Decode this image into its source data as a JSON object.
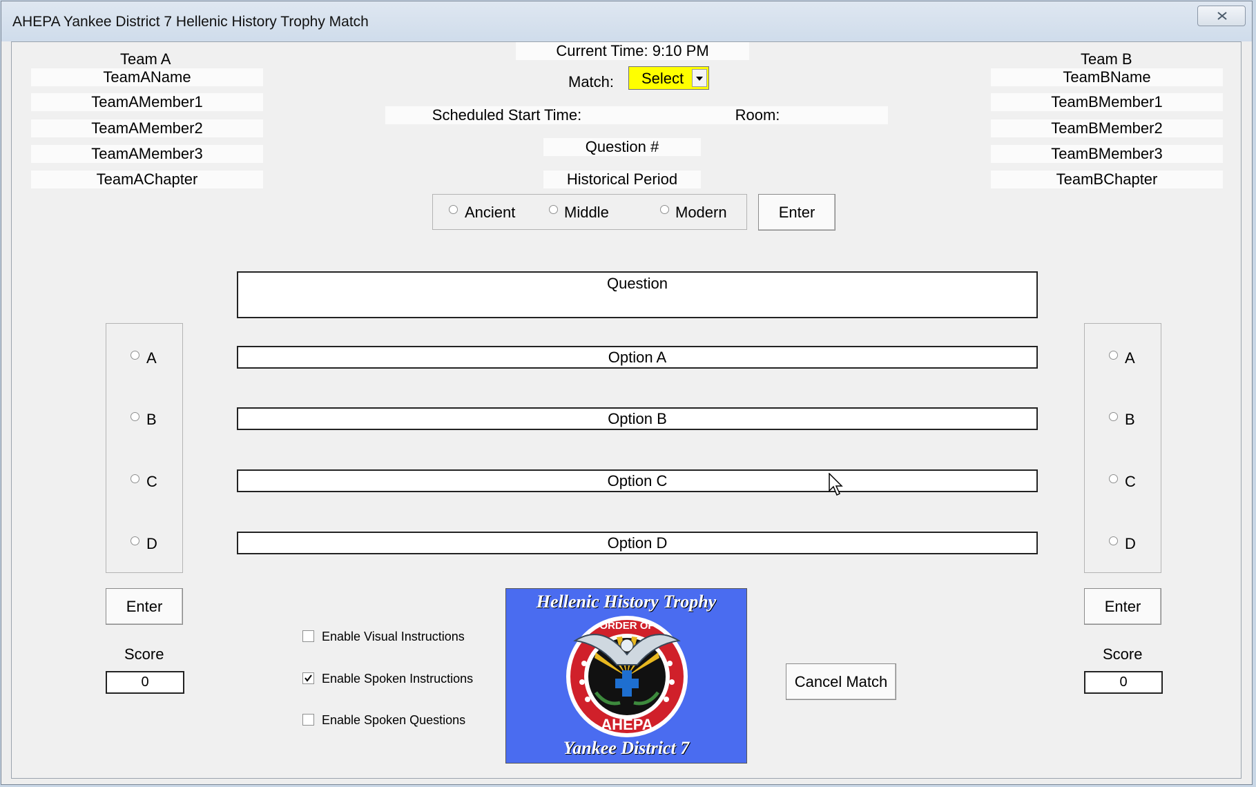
{
  "window": {
    "title": "AHEPA Yankee District 7 Hellenic History Trophy Match"
  },
  "teamA": {
    "header": "Team A",
    "name": "TeamAName",
    "member1": "TeamAMember1",
    "member2": "TeamAMember2",
    "member3": "TeamAMember3",
    "chapter": "TeamAChapter",
    "answers": [
      "A",
      "B",
      "C",
      "D"
    ],
    "enter_label": "Enter",
    "score_label": "Score",
    "score_value": "0"
  },
  "teamB": {
    "header": "Team B",
    "name": "TeamBName",
    "member1": "TeamBMember1",
    "member2": "TeamBMember2",
    "member3": "TeamBMember3",
    "chapter": "TeamBChapter",
    "answers": [
      "A",
      "B",
      "C",
      "D"
    ],
    "enter_label": "Enter",
    "score_label": "Score",
    "score_value": "0"
  },
  "center": {
    "current_time": "Current Time: 9:10 PM",
    "match_label": "Match:",
    "match_select_value": "Select",
    "match_select_color": "#ffff00",
    "scheduled_start": "Scheduled Start Time:",
    "room": "Room:",
    "question_number": "Question #",
    "historical_period": "Historical Period",
    "periods": [
      "Ancient",
      "Middle",
      "Modern"
    ],
    "period_enter_label": "Enter",
    "question": "Question",
    "options": [
      "Option A",
      "Option B",
      "Option C",
      "Option D"
    ],
    "cancel_label": "Cancel Match"
  },
  "settings": {
    "visual_instructions": {
      "label": "Enable Visual Instructions",
      "checked": false
    },
    "spoken_instructions": {
      "label": "Enable Spoken Instructions",
      "checked": true
    },
    "spoken_questions": {
      "label": "Enable Spoken Questions",
      "checked": false
    }
  },
  "logo": {
    "top_text": "Hellenic History Trophy",
    "bottom_text": "Yankee District 7",
    "ring_top": "ORDER OF",
    "ring_bottom": "AHEPA",
    "background_color": "#4a6cf0"
  }
}
